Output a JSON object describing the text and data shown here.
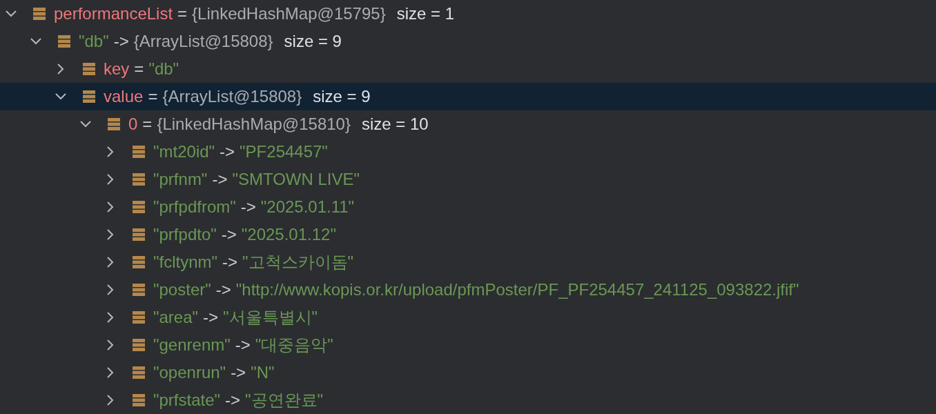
{
  "tree": [
    {
      "kind": "field",
      "name": "performanceList",
      "sep": "=",
      "value": "{LinkedHashMap@15795}",
      "size": "size = 1",
      "expanded": true,
      "selected": false,
      "children": [
        {
          "kind": "entry",
          "name": "\"db\"",
          "sep": "->",
          "value": "{ArrayList@15808}",
          "size": "size = 9",
          "expanded": true,
          "selected": false,
          "children": [
            {
              "kind": "field",
              "name": "key",
              "sep": "=",
              "value": "\"db\"",
              "expanded": false,
              "selected": false
            },
            {
              "kind": "field",
              "name": "value",
              "sep": "=",
              "value": "{ArrayList@15808}",
              "size": "size = 9",
              "expanded": true,
              "selected": true,
              "children": [
                {
                  "kind": "field",
                  "name": "0",
                  "sep": "=",
                  "value": "{LinkedHashMap@15810}",
                  "size": "size = 10",
                  "expanded": true,
                  "selected": false,
                  "children": [
                    {
                      "kind": "entry",
                      "name": "\"mt20id\"",
                      "sep": "->",
                      "value": "\"PF254457\"",
                      "expanded": false,
                      "selected": false
                    },
                    {
                      "kind": "entry",
                      "name": "\"prfnm\"",
                      "sep": "->",
                      "value": "\"SMTOWN LIVE\"",
                      "expanded": false,
                      "selected": false
                    },
                    {
                      "kind": "entry",
                      "name": "\"prfpdfrom\"",
                      "sep": "->",
                      "value": "\"2025.01.11\"",
                      "expanded": false,
                      "selected": false
                    },
                    {
                      "kind": "entry",
                      "name": "\"prfpdto\"",
                      "sep": "->",
                      "value": "\"2025.01.12\"",
                      "expanded": false,
                      "selected": false
                    },
                    {
                      "kind": "entry",
                      "name": "\"fcltynm\"",
                      "sep": "->",
                      "value": "\"고척스카이돔\"",
                      "expanded": false,
                      "selected": false
                    },
                    {
                      "kind": "entry",
                      "name": "\"poster\"",
                      "sep": "->",
                      "value": "\"http://www.kopis.or.kr/upload/pfmPoster/PF_PF254457_241125_093822.jfif\"",
                      "expanded": false,
                      "selected": false
                    },
                    {
                      "kind": "entry",
                      "name": "\"area\"",
                      "sep": "->",
                      "value": "\"서울특별시\"",
                      "expanded": false,
                      "selected": false
                    },
                    {
                      "kind": "entry",
                      "name": "\"genrenm\"",
                      "sep": "->",
                      "value": "\"대중음악\"",
                      "expanded": false,
                      "selected": false
                    },
                    {
                      "kind": "entry",
                      "name": "\"openrun\"",
                      "sep": "->",
                      "value": "\"N\"",
                      "expanded": false,
                      "selected": false
                    },
                    {
                      "kind": "entry",
                      "name": "\"prfstate\"",
                      "sep": "->",
                      "value": "\"공연완료\"",
                      "expanded": false,
                      "selected": false
                    }
                  ]
                }
              ]
            }
          ]
        }
      ]
    }
  ]
}
